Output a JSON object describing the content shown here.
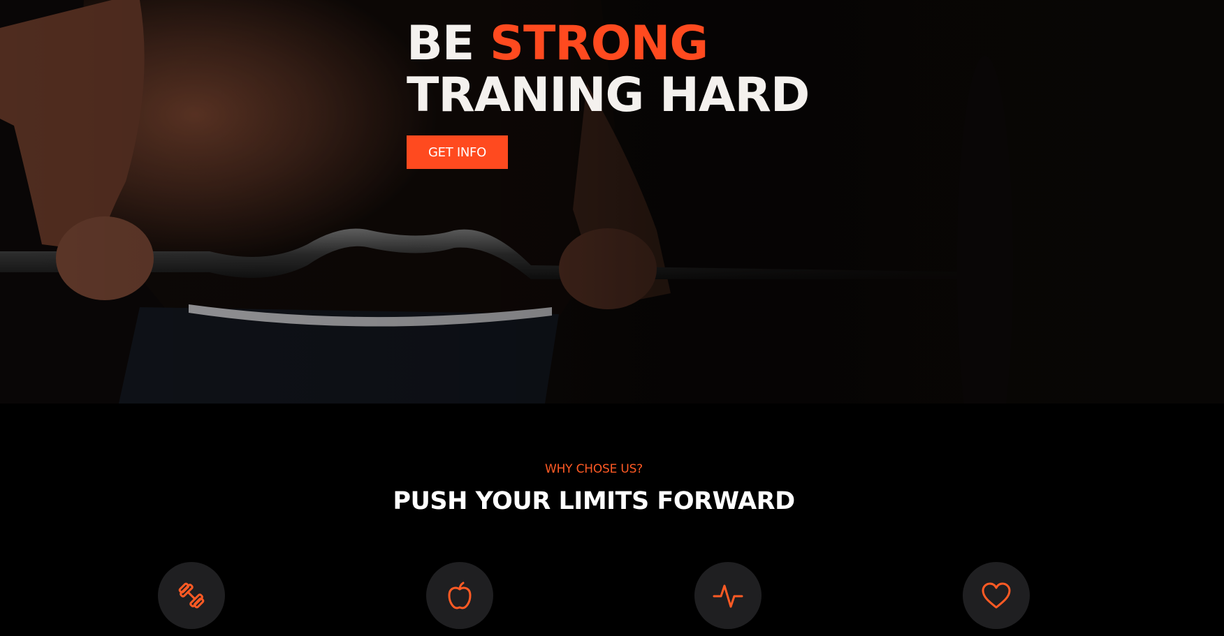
{
  "hero": {
    "line1_word1": "BE",
    "line1_word2": "STRONG",
    "line2": "TRANING HARD",
    "button_label": "GET INFO"
  },
  "why": {
    "eyebrow": "WHY CHOSE US?",
    "title": "PUSH YOUR LIMITS FORWARD"
  },
  "features": [
    {
      "icon": "dumbbell-icon"
    },
    {
      "icon": "apple-icon"
    },
    {
      "icon": "pulse-icon"
    },
    {
      "icon": "heart-icon"
    }
  ],
  "colors": {
    "accent": "#ff4a1f",
    "background": "#000000",
    "icon_circle": "#1f1f21",
    "heading": "#ffffff"
  }
}
